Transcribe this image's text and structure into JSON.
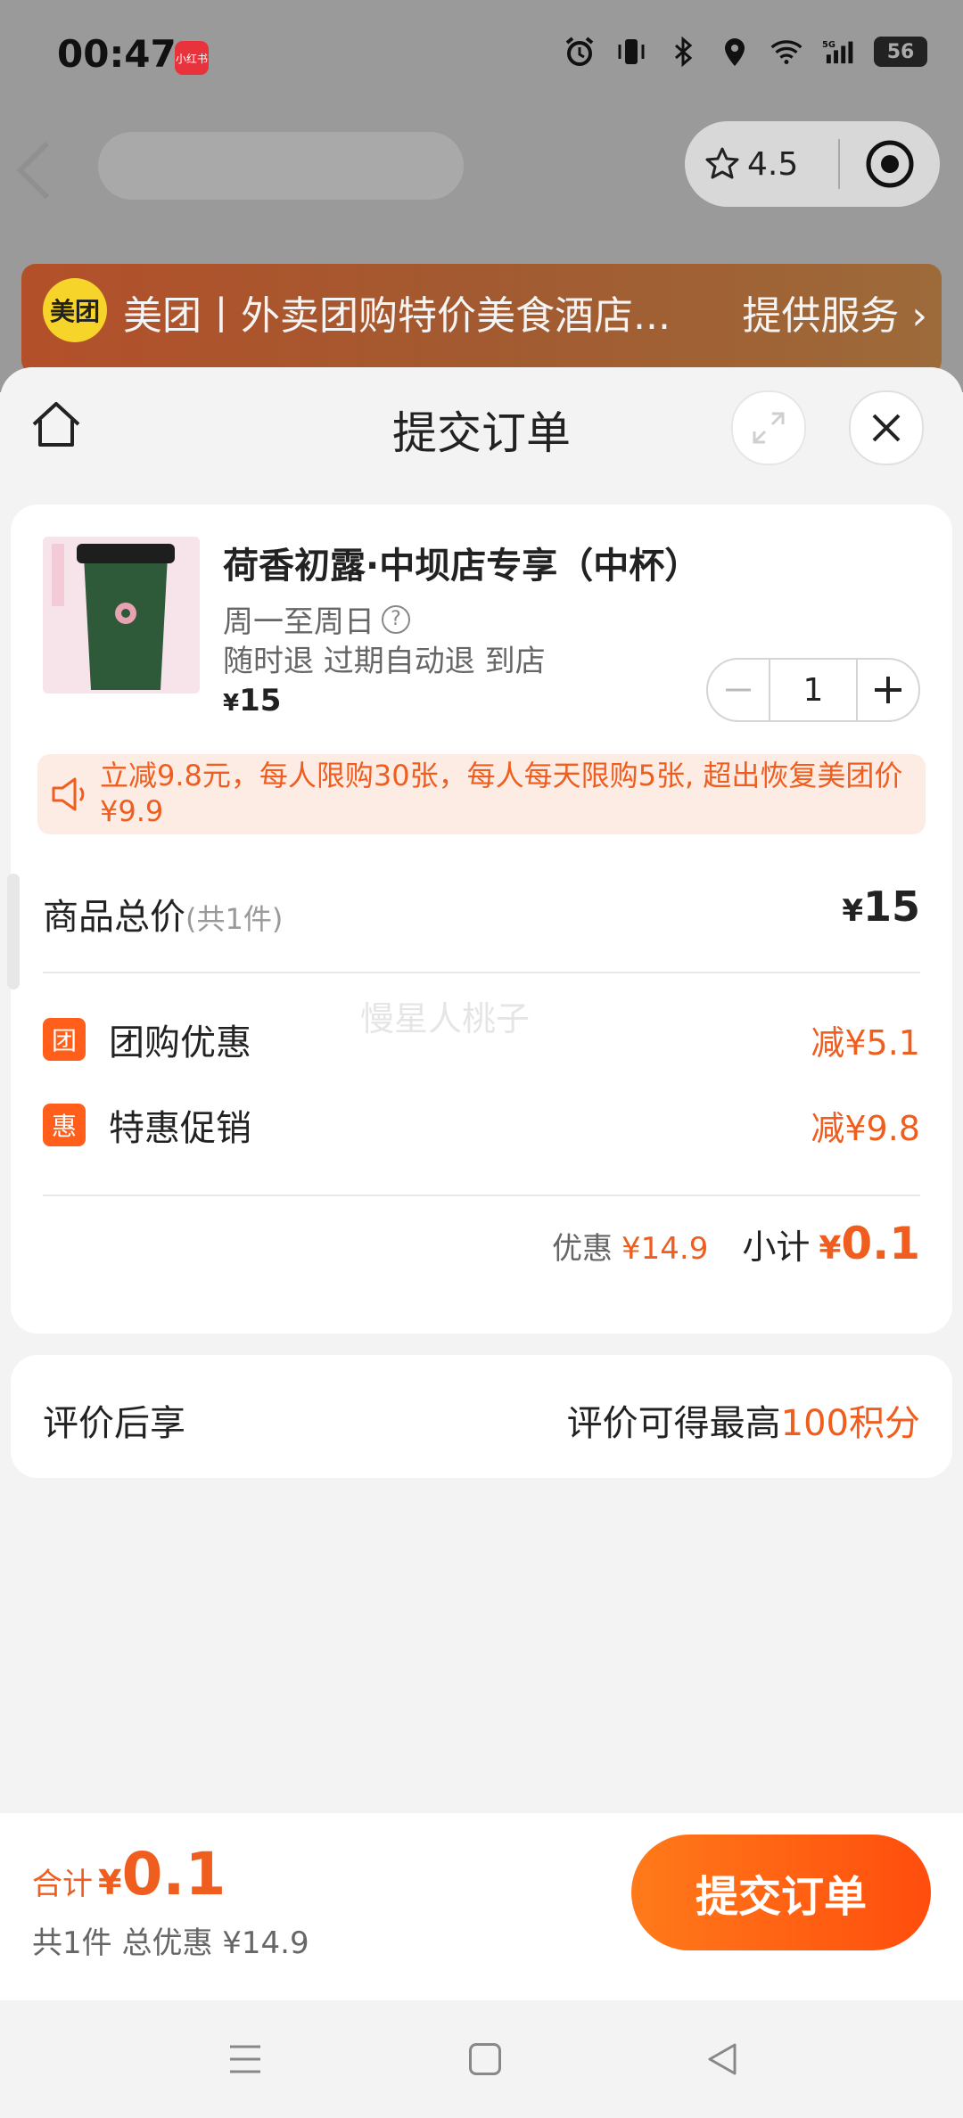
{
  "status_bar": {
    "time": "00:47",
    "app_badge": "小红书",
    "icons": [
      "alarm-icon",
      "vibrate-icon",
      "bluetooth-icon",
      "location-icon",
      "wifi-icon",
      "5g-signal-icon"
    ],
    "battery": "56"
  },
  "capsule": {
    "rating": "4.5"
  },
  "banner": {
    "logo": "美团",
    "title": "美团丨外卖团购特价美食酒店...",
    "action": "提供服务"
  },
  "sheet": {
    "title": "提交订单"
  },
  "product": {
    "name": "荷香初露·中坝店专享（中杯）",
    "days": "周一至周日",
    "help": "?",
    "policy": "随时退 过期自动退 到店",
    "price_symbol": "¥",
    "price": "15",
    "quantity": "1"
  },
  "promo": {
    "text": "立减9.8元，每人限购30张，每人每天限购5张, 超出恢复美团价¥9.9"
  },
  "totals": {
    "items_label": "商品总价",
    "items_count": "(共1件)",
    "items_value_symbol": "¥",
    "items_value": "15",
    "discounts": [
      {
        "badge": "团",
        "label": "团购优惠",
        "value": "减¥5.1"
      },
      {
        "badge": "惠",
        "label": "特惠促销",
        "value": "减¥9.8"
      }
    ],
    "discount_label": "优惠",
    "discount_value": "¥14.9",
    "subtotal_label": "小计",
    "subtotal_symbol": "¥",
    "subtotal_value": "0.1"
  },
  "review": {
    "label": "评价后享",
    "value_prefix": "评价可得最高",
    "value_accent": "100积分"
  },
  "watermark": "慢星人桃子",
  "bottom": {
    "total_label": "合计",
    "total_symbol": "¥",
    "total_value": "0.1",
    "total_sub": "共1件 总优惠 ¥14.9",
    "submit": "提交订单"
  },
  "colors": {
    "accent": "#ef5d1f",
    "button_start": "#ff7a1a",
    "button_end": "#ff4d0d",
    "promo_bg": "#fdece4"
  }
}
